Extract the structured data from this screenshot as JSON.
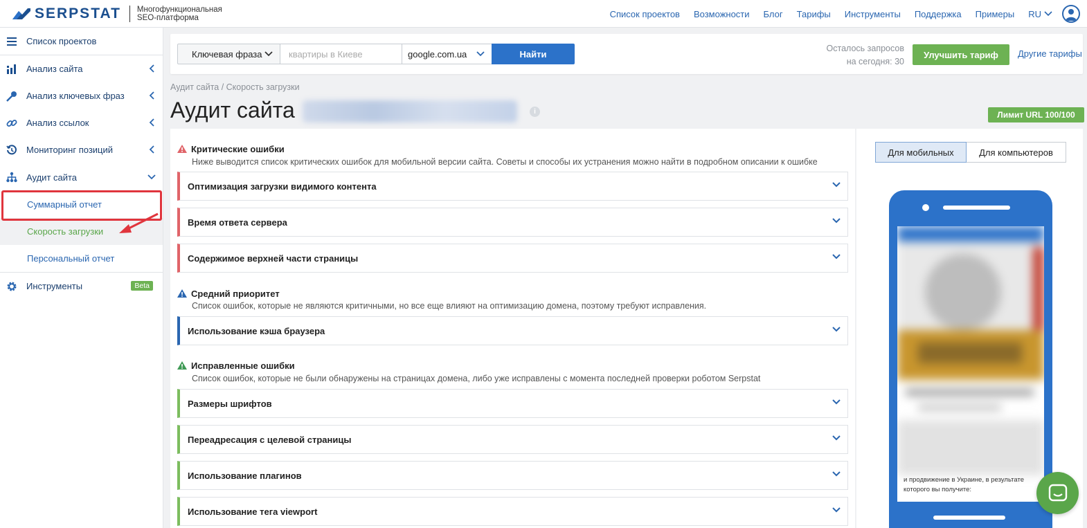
{
  "brand": {
    "name": "SERPSTAT",
    "tagline_line1": "Многофункциональная",
    "tagline_line2": "SEO-платформа",
    "accent_color": "#2c72c9",
    "green_color": "#6db253",
    "red_color": "#e0353d"
  },
  "topnav": {
    "items": [
      "Список проектов",
      "Возможности",
      "Блог",
      "Тарифы",
      "Инструменты",
      "Поддержка",
      "Примеры"
    ],
    "lang": "RU"
  },
  "sidebar": {
    "items": [
      {
        "label": "Список проектов",
        "icon": "hamburger-icon"
      },
      {
        "label": "Анализ сайта",
        "icon": "chart-icon"
      },
      {
        "label": "Анализ ключевых фраз",
        "icon": "key-icon"
      },
      {
        "label": "Анализ ссылок",
        "icon": "link-icon"
      },
      {
        "label": "Мониторинг позиций",
        "icon": "history-icon"
      },
      {
        "label": "Аудит сайта",
        "icon": "sitemap-icon"
      }
    ],
    "sub_items": [
      "Суммарный отчет",
      "Скорость загрузки",
      "Персональный отчет"
    ],
    "tools_label": "Инструменты",
    "beta_label": "Beta"
  },
  "search": {
    "type_label": "Ключевая фраза",
    "input_placeholder": "квартиры в Киеве",
    "database": "google.com.ua",
    "find_button": "Найти",
    "quota_line1": "Осталось запросов",
    "quota_line2": "на сегодня: 30",
    "upgrade_button": "Улучшить тариф",
    "other_plans": "Другие тарифы"
  },
  "page": {
    "breadcrumb": "Аудит сайта / Скорость загрузки",
    "title": "Аудит сайта",
    "info_symbol": "i",
    "limit_badge": "Лимит URL 100/100"
  },
  "sections": {
    "critical": {
      "title": "Критические ошибки",
      "desc": "Ниже выводится список критических ошибок для мобильной версии сайта. Советы и способы их устранения можно найти в подробном описании к ошибке",
      "items": [
        "Оптимизация загрузки видимого контента",
        "Время ответа сервера",
        "Содержимое верхней части страницы"
      ]
    },
    "medium": {
      "title": "Средний приоритет",
      "desc": "Список ошибок, которые не являются критичными, но все еще влияют на оптимизацию домена, поэтому требуют исправления.",
      "items": [
        "Использование кэша браузера"
      ]
    },
    "fixed": {
      "title": "Исправленные ошибки",
      "desc": "Список ошибок, которые не были обнаружены на страницах домена, либо уже исправлены с момента последней проверки роботом Serpstat",
      "items": [
        "Размеры шрифтов",
        "Переадресация с целевой страницы",
        "Использование плагинов",
        "Использование тега viewport"
      ]
    }
  },
  "preview": {
    "tab_mobile": "Для мобильных",
    "tab_desktop": "Для компьютеров",
    "screen_text_line1": "и продвижение в Украине, в результате",
    "screen_text_line2": "которого вы получите:"
  }
}
